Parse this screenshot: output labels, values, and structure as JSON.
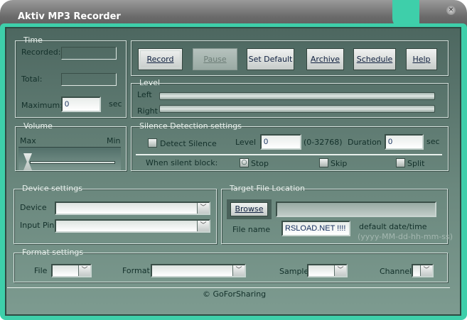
{
  "window": {
    "title": "Aktiv MP3 Recorder",
    "close_glyph": "×"
  },
  "time": {
    "legend": "Time",
    "recorded_label": "Recorded:",
    "recorded_value": "",
    "total_label": "Total:",
    "total_value": "",
    "maximum_label": "Maximum:",
    "maximum_value": "0",
    "unit": "sec"
  },
  "toolbar": {
    "record": "Record",
    "pause": "Pause",
    "set_default": "Set Default",
    "archive": "Archive",
    "schedule": "Schedule",
    "help": "Help"
  },
  "level": {
    "legend": "Level",
    "left_label": "Left",
    "right_label": "Right",
    "left_value": 0,
    "right_value": 0
  },
  "volume": {
    "legend": "Volume",
    "max_label": "Max",
    "min_label": "Min",
    "value": 0
  },
  "silence": {
    "legend": "Silence Detection settings",
    "detect_label": "Detect Silence",
    "detect_checked": false,
    "level_label": "Level",
    "level_value": "0",
    "level_range": "(0-32768)",
    "duration_label": "Duration",
    "duration_value": "0",
    "duration_unit": "sec",
    "when_label": "When silent block:",
    "stop_label": "Stop",
    "skip_label": "Skip",
    "split_label": "Split",
    "selected_action": "Stop"
  },
  "device": {
    "legend": "Device settings",
    "device_label": "Device",
    "device_value": "",
    "input_pin_label": "Input Pin",
    "input_pin_value": ""
  },
  "target": {
    "legend": "Target File Location",
    "browse_label": "Browse",
    "path_value": "",
    "file_name_label": "File name",
    "file_name_value": "RSLOAD.NET !!!!",
    "default_label": "default date/time",
    "default_format": "(yyyy-MM-dd-hh-mm-ss)"
  },
  "format": {
    "legend": "Format settings",
    "file_label": "File",
    "file_value": "",
    "format_label": "Format",
    "format_value": "",
    "sample_label": "Sample",
    "sample_value": "",
    "channel_label": "Channel",
    "channel_value": ""
  },
  "footer": {
    "copyright": "© GoForSharing"
  },
  "colors": {
    "frame": "#3ecfaa",
    "panel": "#5d7a71"
  }
}
